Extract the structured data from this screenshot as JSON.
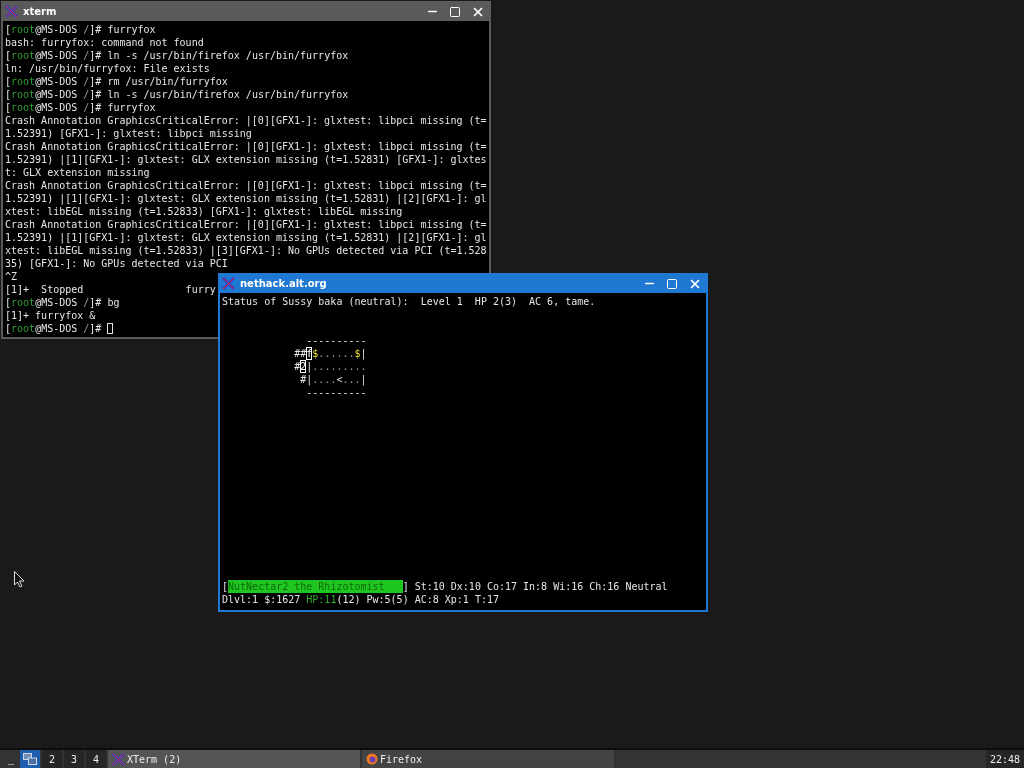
{
  "windows": [
    {
      "kind": "xterm",
      "title": "xterm",
      "active": false,
      "cursor": true,
      "lines": [
        {
          "kind": "prompt",
          "segments": [
            {
              "text": "[",
              "kind": "plain"
            },
            {
              "text": "root",
              "kind": "user"
            },
            {
              "text": "@MS-DOS ",
              "kind": "plain"
            },
            {
              "text": "/",
              "kind": "dir"
            },
            {
              "text": "]# furryfox",
              "kind": "plain"
            }
          ]
        },
        {
          "kind": "output",
          "text": "bash: furryfox: command not found"
        },
        {
          "kind": "prompt",
          "segments": [
            {
              "text": "[",
              "kind": "plain"
            },
            {
              "text": "root",
              "kind": "user"
            },
            {
              "text": "@MS-DOS ",
              "kind": "plain"
            },
            {
              "text": "/",
              "kind": "dir"
            },
            {
              "text": "]# ln -s /usr/bin/firefox /usr/bin/furryfox",
              "kind": "plain"
            }
          ]
        },
        {
          "kind": "output",
          "text": "ln: /usr/bin/furryfox: File exists"
        },
        {
          "kind": "prompt",
          "segments": [
            {
              "text": "[",
              "kind": "plain"
            },
            {
              "text": "root",
              "kind": "user"
            },
            {
              "text": "@MS-DOS ",
              "kind": "plain"
            },
            {
              "text": "/",
              "kind": "dir"
            },
            {
              "text": "]# rm /usr/bin/furryfox",
              "kind": "plain"
            }
          ]
        },
        {
          "kind": "prompt",
          "segments": [
            {
              "text": "[",
              "kind": "plain"
            },
            {
              "text": "root",
              "kind": "user"
            },
            {
              "text": "@MS-DOS ",
              "kind": "plain"
            },
            {
              "text": "/",
              "kind": "dir"
            },
            {
              "text": "]# ln -s /usr/bin/firefox /usr/bin/furryfox",
              "kind": "plain"
            }
          ]
        },
        {
          "kind": "prompt",
          "segments": [
            {
              "text": "[",
              "kind": "plain"
            },
            {
              "text": "root",
              "kind": "user"
            },
            {
              "text": "@MS-DOS ",
              "kind": "plain"
            },
            {
              "text": "/",
              "kind": "dir"
            },
            {
              "text": "]# furryfox",
              "kind": "plain"
            }
          ]
        },
        {
          "kind": "output",
          "text": "Crash Annotation GraphicsCriticalError: |[0][GFX1-]: glxtest: libpci missing (t="
        },
        {
          "kind": "output",
          "text": "1.52391) [GFX1-]: glxtest: libpci missing"
        },
        {
          "kind": "output",
          "text": "Crash Annotation GraphicsCriticalError: |[0][GFX1-]: glxtest: libpci missing (t="
        },
        {
          "kind": "output",
          "text": "1.52391) |[1][GFX1-]: glxtest: GLX extension missing (t=1.52831) [GFX1-]: glxtes"
        },
        {
          "kind": "output",
          "text": "t: GLX extension missing"
        },
        {
          "kind": "output",
          "text": "Crash Annotation GraphicsCriticalError: |[0][GFX1-]: glxtest: libpci missing (t="
        },
        {
          "kind": "output",
          "text": "1.52391) |[1][GFX1-]: glxtest: GLX extension missing (t=1.52831) |[2][GFX1-]: gl"
        },
        {
          "kind": "output",
          "text": "xtest: libEGL missing (t=1.52833) [GFX1-]: glxtest: libEGL missing"
        },
        {
          "kind": "output",
          "text": "Crash Annotation GraphicsCriticalError: |[0][GFX1-]: glxtest: libpci missing (t="
        },
        {
          "kind": "output",
          "text": "1.52391) |[1][GFX1-]: glxtest: GLX extension missing (t=1.52831) |[2][GFX1-]: gl"
        },
        {
          "kind": "output",
          "text": "xtest: libEGL missing (t=1.52833) |[3][GFX1-]: No GPUs detected via PCI (t=1.528"
        },
        {
          "kind": "output",
          "text": "35) [GFX1-]: No GPUs detected via PCI"
        },
        {
          "kind": "output",
          "text": "^Z"
        },
        {
          "kind": "output",
          "text": "[1]+  Stopped                 furry"
        },
        {
          "kind": "prompt",
          "segments": [
            {
              "text": "[",
              "kind": "plain"
            },
            {
              "text": "root",
              "kind": "user"
            },
            {
              "text": "@MS-DOS ",
              "kind": "plain"
            },
            {
              "text": "/",
              "kind": "dir"
            },
            {
              "text": "]# bg",
              "kind": "plain"
            }
          ]
        },
        {
          "kind": "output",
          "text": "[1]+ furryfox &"
        },
        {
          "kind": "prompt",
          "segments": [
            {
              "text": "[",
              "kind": "plain"
            },
            {
              "text": "root",
              "kind": "user"
            },
            {
              "text": "@MS-DOS ",
              "kind": "plain"
            },
            {
              "text": "/",
              "kind": "dir"
            },
            {
              "text": "]# ",
              "kind": "plain"
            }
          ]
        }
      ]
    },
    {
      "kind": "nethack",
      "title": "nethack.alt.org",
      "active": true,
      "message": "Status of Sussy baka (neutral):  Level 1  HP 2(3)  AC 6, tame.",
      "map": [
        [
          {
            "text": "              ----------",
            "kind": "wall"
          }
        ],
        [
          {
            "text": "            ##",
            "kind": "plain"
          },
          {
            "text": "f",
            "kind": "pet"
          },
          {
            "text": "$",
            "kind": "gold"
          },
          {
            "text": "......",
            "kind": "floor"
          },
          {
            "text": "$",
            "kind": "gold"
          },
          {
            "text": "|",
            "kind": "wall"
          }
        ],
        [
          {
            "text": "            #",
            "kind": "plain"
          },
          {
            "text": "2",
            "kind": "pet"
          },
          {
            "text": "|",
            "kind": "wall"
          },
          {
            "text": ".........",
            "kind": "floor"
          }
        ],
        [
          {
            "text": "             #",
            "kind": "plain"
          },
          {
            "text": "|",
            "kind": "wall"
          },
          {
            "text": "....",
            "kind": "floor"
          },
          {
            "text": "<",
            "kind": "plain"
          },
          {
            "text": "...",
            "kind": "floor"
          },
          {
            "text": "|",
            "kind": "wall"
          }
        ],
        [
          {
            "text": "              ----------",
            "kind": "wall"
          }
        ]
      ],
      "status": [
        [
          {
            "text": "[",
            "kind": "plain"
          },
          {
            "text": "NutNectar2 the Rhizotomist   ",
            "kind": "hilite"
          },
          {
            "text": "] St:10 Dx:10 Co:17 In:8 Wi:16 Ch:16 Neutral",
            "kind": "plain"
          }
        ],
        [
          {
            "text": "Dlvl:1 $:1627 ",
            "kind": "plain"
          },
          {
            "text": "HP:11",
            "kind": "hp"
          },
          {
            "text": "(12) Pw:5(5) AC:8 Xp:1 T:17",
            "kind": "plain"
          }
        ]
      ]
    }
  ],
  "taskbar": {
    "menu": "_",
    "workspaces": [
      {
        "kind": "pager",
        "selected": true
      },
      {
        "label": "2",
        "selected": false
      },
      {
        "label": "3",
        "selected": false
      },
      {
        "label": "4",
        "selected": false
      }
    ],
    "tasks": [
      {
        "kind": "xterm",
        "label": "XTerm (2)",
        "selected": true
      },
      {
        "kind": "browser",
        "label": "Firefox",
        "selected": false
      }
    ],
    "clock": "22:48"
  }
}
